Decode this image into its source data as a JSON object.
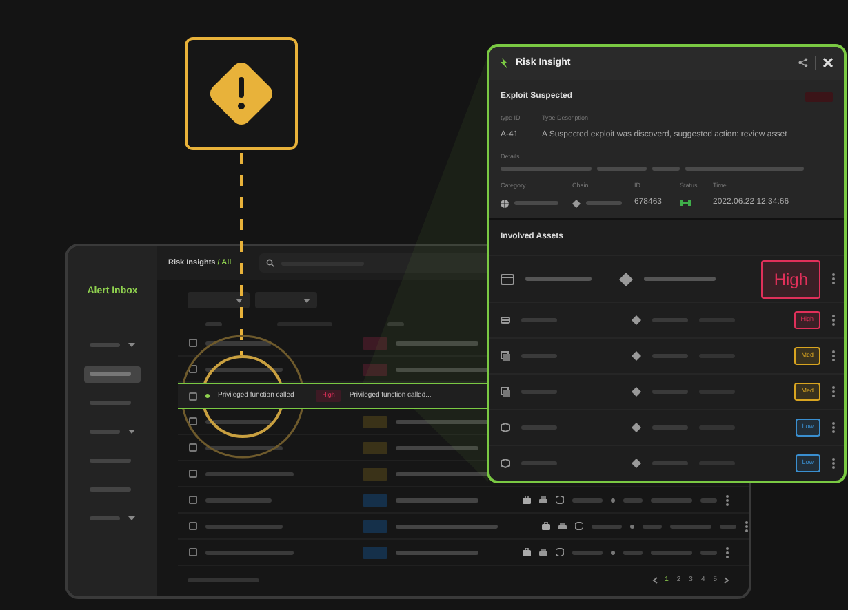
{
  "sidebar": {
    "title": "Alert Inbox",
    "items": [
      {
        "selected": false
      },
      {
        "selected": true
      },
      {
        "selected": false
      },
      {
        "selected": false
      },
      {
        "selected": false
      },
      {
        "selected": false
      },
      {
        "selected": false
      }
    ]
  },
  "header": {
    "title": "Risk Insights",
    "scope": "/ All"
  },
  "table": {
    "rows": [
      {
        "selected": false,
        "kind": "compact",
        "color": "#3d1a24"
      },
      {
        "selected": false,
        "kind": "compact",
        "color": "#3d1a24"
      },
      {
        "selected": true,
        "kind": "compact",
        "color": "#3d1a24",
        "name": "Privileged function called",
        "severity": "High",
        "description": "Privileged function called..."
      },
      {
        "selected": false,
        "kind": "compact",
        "color": "#3a3218"
      },
      {
        "selected": false,
        "kind": "compact",
        "color": "#3a3218"
      },
      {
        "selected": false,
        "kind": "compact",
        "color": "#3a3218"
      },
      {
        "selected": false,
        "kind": "full",
        "color": "#15304a"
      },
      {
        "selected": false,
        "kind": "full",
        "color": "#15304a"
      },
      {
        "selected": false,
        "kind": "full",
        "color": "#15304a"
      }
    ]
  },
  "pagination": [
    {
      "label": "1",
      "selected": true
    },
    {
      "label": "2",
      "selected": false
    },
    {
      "label": "3",
      "selected": false
    },
    {
      "label": "4",
      "selected": false
    },
    {
      "label": "5",
      "selected": false
    }
  ],
  "panel": {
    "title": "Risk Insight",
    "alert": {
      "title": "Exploit Suspected",
      "type_id_label": "type ID",
      "type_description_label": "Type Description",
      "type_id": "A-41",
      "type_description": "A Suspected exploit was discoverd, suggested action: review asset",
      "details_label": "Details",
      "fields": [
        {
          "label": "Category",
          "kind": "category"
        },
        {
          "label": "Chain",
          "kind": "chain"
        },
        {
          "label": "ID",
          "kind": "text",
          "value": "678463"
        },
        {
          "label": "Status",
          "kind": "status"
        },
        {
          "label": "Time",
          "kind": "text",
          "value": "2022.06.22 12:34:66"
        }
      ]
    },
    "assets_title": "Involved Assets",
    "assets": [
      {
        "kind": "device",
        "featured": true,
        "severity": "High",
        "color": "#e0305a"
      },
      {
        "kind": "device",
        "featured": false,
        "severity": "High",
        "color": "#e0305a"
      },
      {
        "kind": "document",
        "featured": false,
        "severity": "Med",
        "color": "#d9a520"
      },
      {
        "kind": "document",
        "featured": false,
        "severity": "Med",
        "color": "#d9a520"
      },
      {
        "kind": "package",
        "featured": false,
        "severity": "Low",
        "color": "#3a8fd0"
      },
      {
        "kind": "package",
        "featured": false,
        "severity": "Low",
        "color": "#3a8fd0"
      }
    ]
  }
}
